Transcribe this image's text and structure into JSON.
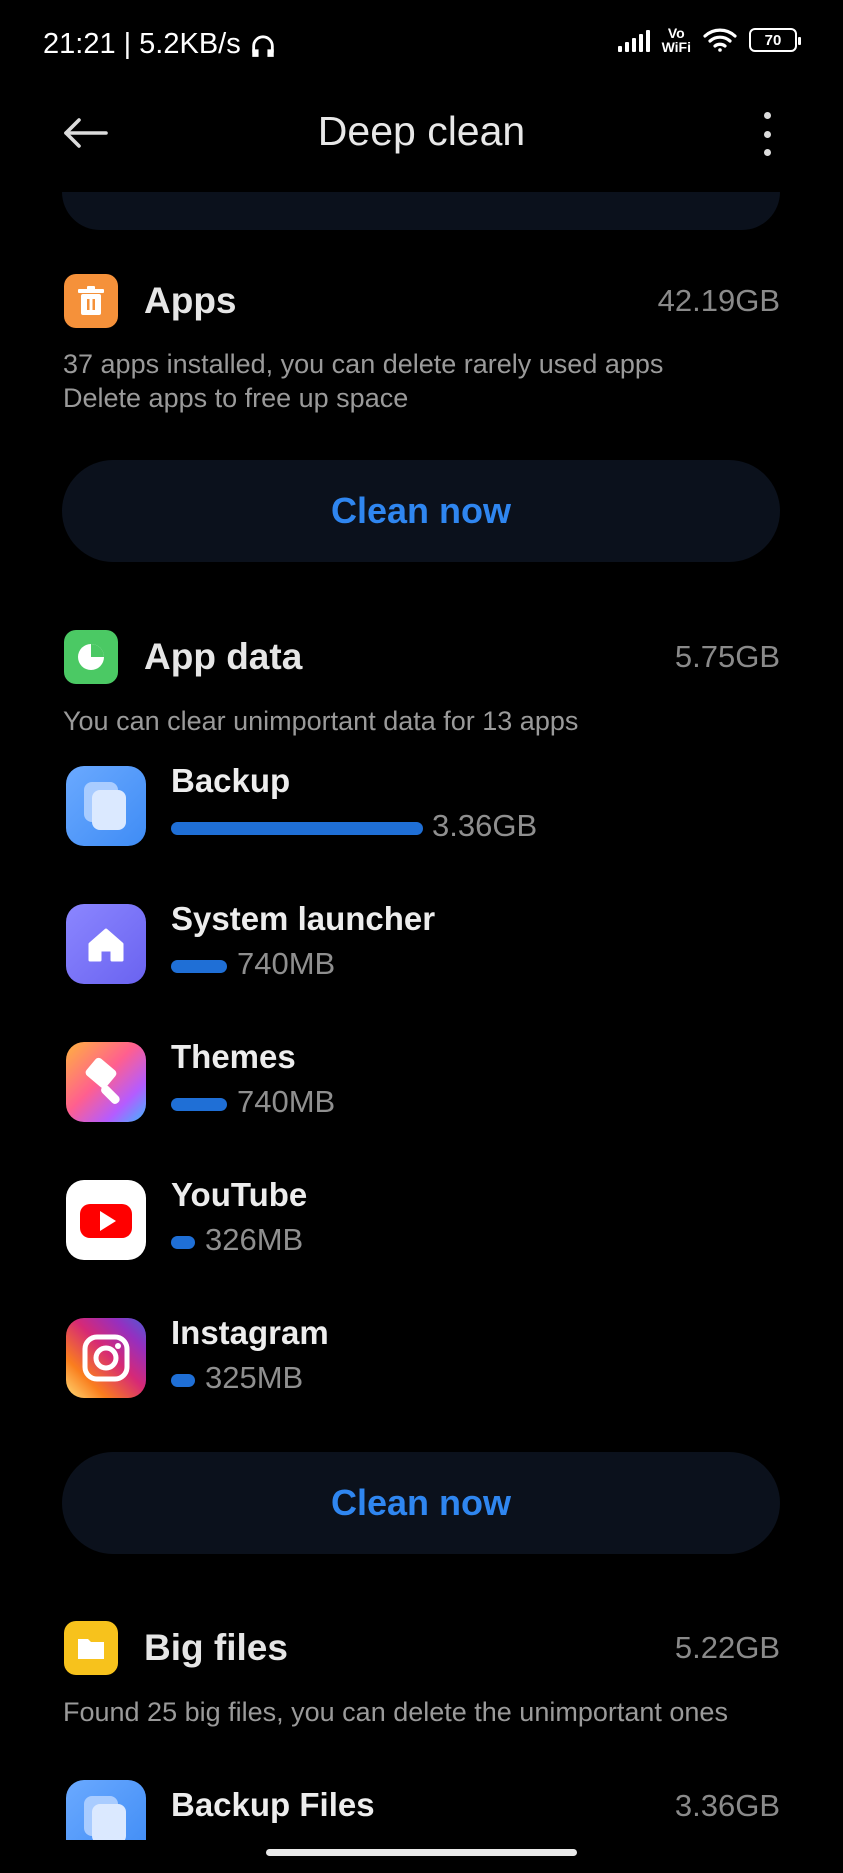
{
  "status_bar": {
    "time": "21:21",
    "net_speed": "| 5.2KB/s",
    "vowifi_top": "Vo",
    "vowifi_bottom": "WiFi",
    "battery": "70",
    "icons": [
      "headphones-icon",
      "signal-icon",
      "wifi-icon",
      "battery-icon"
    ]
  },
  "header": {
    "title": "Deep clean",
    "back_icon": "arrow-left-icon",
    "more_icon": "more-vertical-icon"
  },
  "sections": {
    "apps": {
      "icon": "trash-icon",
      "icon_color": "#f5913a",
      "title": "Apps",
      "size": "42.19GB",
      "desc_line1": "37 apps installed, you can delete rarely used apps",
      "desc_line2": "Delete apps to free up space",
      "button": "Clean now"
    },
    "app_data": {
      "icon": "pie-chart-icon",
      "icon_color": "#4bc964",
      "title": "App data",
      "size": "5.75GB",
      "desc": "You can clear unimportant data for 13 apps",
      "button": "Clean now",
      "items": [
        {
          "name": "Backup",
          "size": "3.36GB",
          "fraction": 1.0,
          "icon": "backup-app-icon"
        },
        {
          "name": "System launcher",
          "size": "740MB",
          "fraction": 0.22,
          "icon": "home-app-icon"
        },
        {
          "name": "Themes",
          "size": "740MB",
          "fraction": 0.22,
          "icon": "themes-app-icon"
        },
        {
          "name": "YouTube",
          "size": "326MB",
          "fraction": 0.1,
          "icon": "youtube-app-icon"
        },
        {
          "name": "Instagram",
          "size": "325MB",
          "fraction": 0.1,
          "icon": "instagram-app-icon"
        }
      ]
    },
    "big_files": {
      "icon": "folder-icon",
      "icon_color": "#f7c21c",
      "title": "Big files",
      "size": "5.22GB",
      "desc": "Found 25 big files, you can delete the unimportant ones",
      "items": [
        {
          "name": "Backup Files",
          "size": "3.36GB",
          "icon": "backup-app-icon"
        }
      ]
    }
  },
  "colors": {
    "background": "#000000",
    "card": "#0b111c",
    "accent": "#2f86f0",
    "bar": "#1f6fd6"
  }
}
